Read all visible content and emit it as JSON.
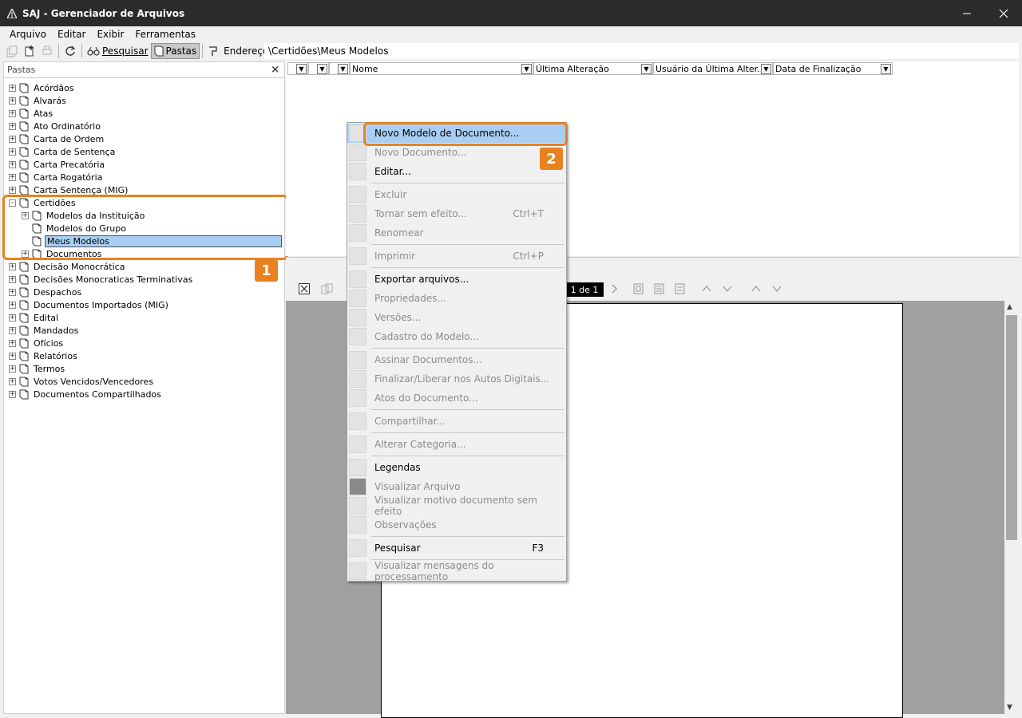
{
  "window": {
    "title": "SAJ - Gerenciador de Arquivos"
  },
  "menubar": {
    "items": [
      "Arquivo",
      "Editar",
      "Exibir",
      "Ferramentas"
    ]
  },
  "toolbar": {
    "search_label": "Pesquisar",
    "folders_label": "Pastas",
    "address_label": "Endereço",
    "address_value": "\\Certidões\\Meus Modelos"
  },
  "left_pane": {
    "header": "Pastas",
    "tree": [
      {
        "label": "Acórdãos",
        "level": 0,
        "expander": "+"
      },
      {
        "label": "Alvarás",
        "level": 0,
        "expander": "+"
      },
      {
        "label": "Atas",
        "level": 0,
        "expander": "+"
      },
      {
        "label": "Ato Ordinatório",
        "level": 0,
        "expander": "+"
      },
      {
        "label": "Carta de Ordem",
        "level": 0,
        "expander": "+"
      },
      {
        "label": "Carta de Sentença",
        "level": 0,
        "expander": "+"
      },
      {
        "label": "Carta Precatória",
        "level": 0,
        "expander": "+"
      },
      {
        "label": "Carta Rogatória",
        "level": 0,
        "expander": "+"
      },
      {
        "label": "Carta Sentença (MIG)",
        "level": 0,
        "expander": "+"
      },
      {
        "label": "Certidões",
        "level": 0,
        "expander": "-"
      },
      {
        "label": "Modelos da Instituição",
        "level": 1,
        "expander": "+"
      },
      {
        "label": "Modelos do Grupo",
        "level": 1,
        "expander": ""
      },
      {
        "label": "Meus Modelos",
        "level": 1,
        "expander": "",
        "selected": true
      },
      {
        "label": "Documentos",
        "level": 1,
        "expander": "+"
      },
      {
        "label": "Decisão Monocrática",
        "level": 0,
        "expander": "+"
      },
      {
        "label": "Decisões Monocraticas Terminativas",
        "level": 0,
        "expander": "+"
      },
      {
        "label": "Despachos",
        "level": 0,
        "expander": "+"
      },
      {
        "label": "Documentos Importados (MIG)",
        "level": 0,
        "expander": "+"
      },
      {
        "label": "Edital",
        "level": 0,
        "expander": "+"
      },
      {
        "label": "Mandados",
        "level": 0,
        "expander": "+"
      },
      {
        "label": "Ofícios",
        "level": 0,
        "expander": "+"
      },
      {
        "label": "Relatórios",
        "level": 0,
        "expander": "+"
      },
      {
        "label": "Termos",
        "level": 0,
        "expander": "+"
      },
      {
        "label": "Votos Vencidos/Vencedores",
        "level": 0,
        "expander": "+"
      },
      {
        "label": "Documentos Compartilhados",
        "level": 0,
        "expander": "+"
      }
    ]
  },
  "grid": {
    "columns": [
      "",
      "",
      "",
      "Nome",
      "Última Alteração",
      "Usuário da Última Alter...",
      "Data de Finalização"
    ]
  },
  "viewer": {
    "page_indicator": "1 de 1"
  },
  "context_menu": {
    "items": [
      {
        "label": "Novo Modelo de Documento...",
        "enabled": true,
        "hover": true
      },
      {
        "label": "Novo Documento...",
        "enabled": false
      },
      {
        "label": "Editar...",
        "enabled": true
      },
      {
        "sep": true
      },
      {
        "label": "Excluir",
        "enabled": false
      },
      {
        "label": "Tornar sem efeito...",
        "enabled": false,
        "shortcut": "Ctrl+T"
      },
      {
        "label": "Renomear",
        "enabled": false
      },
      {
        "sep": true
      },
      {
        "label": "Imprimir",
        "enabled": false,
        "shortcut": "Ctrl+P"
      },
      {
        "sep": true
      },
      {
        "label": "Exportar arquivos...",
        "enabled": true
      },
      {
        "label": "Propriedades...",
        "enabled": false
      },
      {
        "label": "Versões...",
        "enabled": false
      },
      {
        "label": "Cadastro do Modelo...",
        "enabled": false
      },
      {
        "sep": true
      },
      {
        "label": "Assinar Documentos...",
        "enabled": false
      },
      {
        "label": "Finalizar/Liberar nos Autos Digitais...",
        "enabled": false
      },
      {
        "label": "Atos do Documento...",
        "enabled": false
      },
      {
        "sep": true
      },
      {
        "label": "Compartilhar...",
        "enabled": false
      },
      {
        "sep": true
      },
      {
        "label": "Alterar Categoria...",
        "enabled": false
      },
      {
        "sep": true
      },
      {
        "label": "Legendas",
        "enabled": true
      },
      {
        "label": "Visualizar Arquivo",
        "enabled": false,
        "dark_icon": true
      },
      {
        "label": "Visualizar motivo documento sem efeito",
        "enabled": false
      },
      {
        "label": "Observações",
        "enabled": false
      },
      {
        "sep": true
      },
      {
        "label": "Pesquisar",
        "enabled": true,
        "shortcut": "F3"
      },
      {
        "sep": true
      },
      {
        "label": "Visualizar mensagens do processamento",
        "enabled": false
      }
    ]
  },
  "annotations": {
    "badge1": "1",
    "badge2": "2"
  },
  "colors": {
    "accent": "#e8811f",
    "selection": "#a9cdf3",
    "titlebar": "#2b2b2b"
  }
}
